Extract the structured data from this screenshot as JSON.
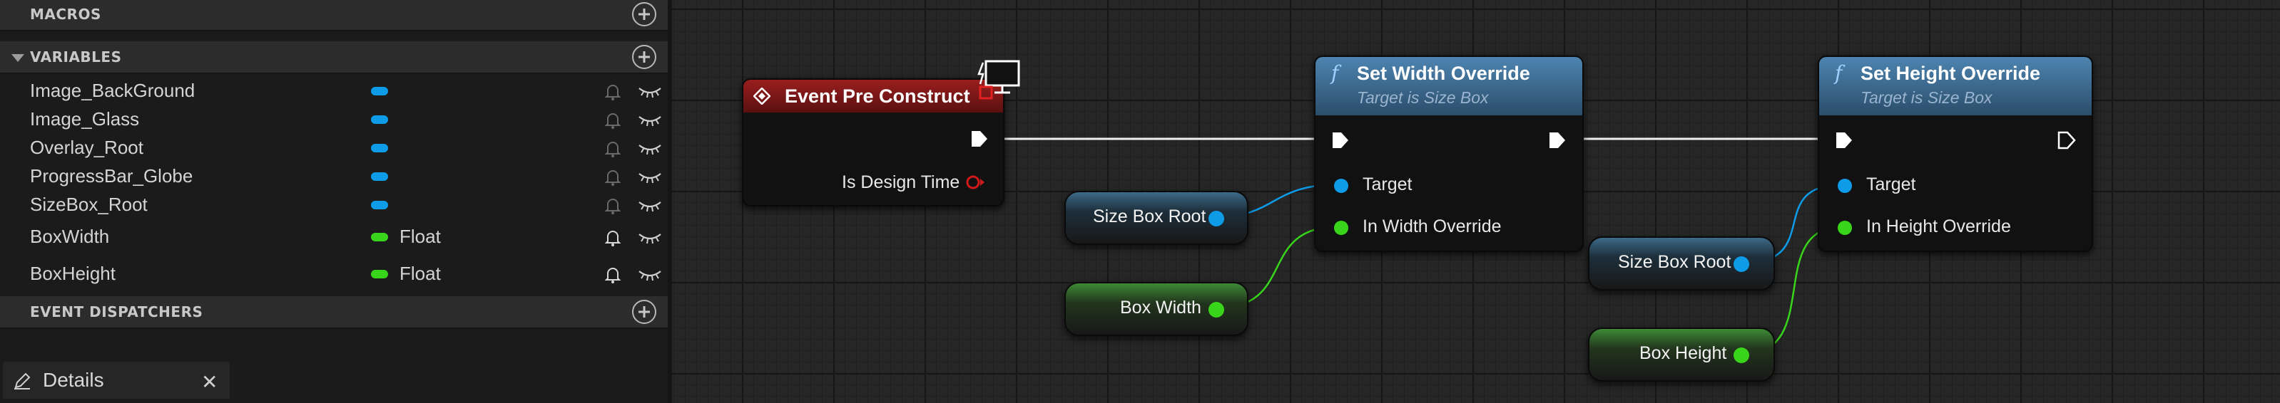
{
  "sidebar": {
    "macros_title": "MACROS",
    "variables_title": "VARIABLES",
    "dispatchers_title": "EVENT DISPATCHERS",
    "variables": [
      {
        "name": "Image_BackGround",
        "type": "",
        "pill_color": "#0e9ce8"
      },
      {
        "name": "Image_Glass",
        "type": "",
        "pill_color": "#0e9ce8"
      },
      {
        "name": "Overlay_Root",
        "type": "",
        "pill_color": "#0e9ce8"
      },
      {
        "name": "ProgressBar_Globe",
        "type": "",
        "pill_color": "#0e9ce8"
      },
      {
        "name": "SizeBox_Root",
        "type": "",
        "pill_color": "#0e9ce8"
      },
      {
        "name": "BoxWidth",
        "type": "Float",
        "pill_color": "#38d51a"
      },
      {
        "name": "BoxHeight",
        "type": "Float",
        "pill_color": "#38d51a"
      }
    ]
  },
  "details_tab": {
    "label": "Details",
    "close_glyph": "✕"
  },
  "graph": {
    "event_node": {
      "title": "Event Pre Construct",
      "pin_label": "Is Design Time"
    },
    "set_width_node": {
      "title": "Set Width Override",
      "subtitle": "Target is Size Box",
      "pin_target": "Target",
      "pin_value": "In Width Override"
    },
    "set_height_node": {
      "title": "Set Height Override",
      "subtitle": "Target is Size Box",
      "pin_target": "Target",
      "pin_value": "In Height Override"
    },
    "getters": {
      "size_box_root_1": "Size Box Root",
      "box_width": "Box Width",
      "size_box_root_2": "Size Box Root",
      "box_height": "Box Height"
    },
    "function_glyph": "f"
  },
  "colors": {
    "object_pin": "#0e9ce8",
    "float_pin": "#38d51a",
    "bool_pin": "#d01a1a",
    "event_header": "#8a1a1a",
    "function_header": "#3e6e94"
  }
}
